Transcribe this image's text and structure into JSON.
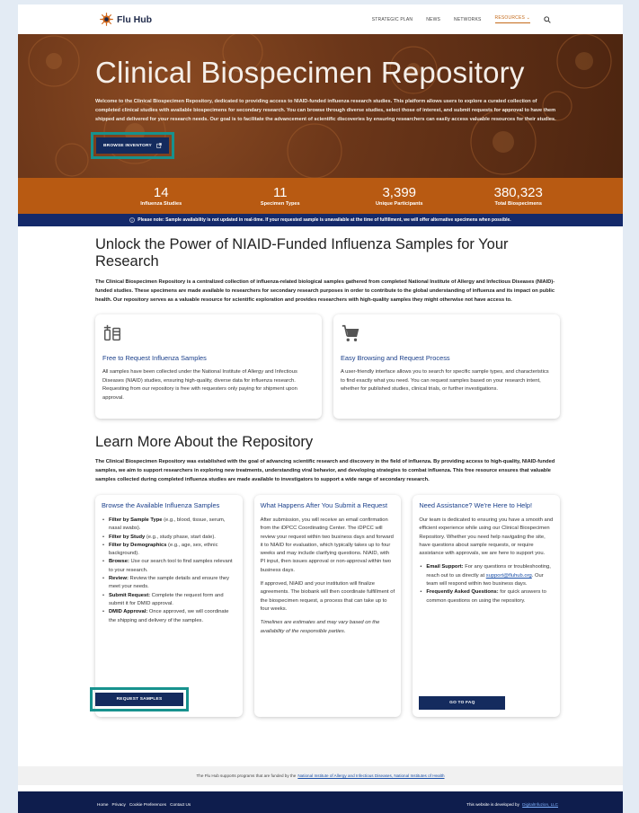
{
  "header": {
    "logo_text": "Flu Hub",
    "nav": [
      "STRATEGIC PLAN",
      "NEWS",
      "NETWORKS",
      "RESOURCES ⌄"
    ],
    "active_nav_index": 3
  },
  "hero": {
    "title": "Clinical Biospecimen Repository",
    "description": "Welcome to the Clinical Biospecimen Repository, dedicated to providing access to NIAID-funded influenza research studies. This platform allows users to explore a curated collection of completed clinical studies with available biospecimens for secondary research. You can browse through diverse studies, select those of interest, and submit requests for approval to have them shipped and delivered for your research needs. Our goal is to facilitate the advancement of scientific discoveries by ensuring researchers can easily access valuable resources for their studies.",
    "browse_label": "BROWSE INVENTORY"
  },
  "stats": [
    {
      "value": "14",
      "label": "Influenza Studies"
    },
    {
      "value": "11",
      "label": "Specimen Types"
    },
    {
      "value": "3,399",
      "label": "Unique Participants"
    },
    {
      "value": "380,323",
      "label": "Total Biospecimens"
    }
  ],
  "notice": "Please note: Sample availability is not updated in real-time. If your requested sample is unavailable at the time of fulfillment, we will offer alternative specimens when possible.",
  "section1": {
    "title": "Unlock the Power of NIAID-Funded Influenza Samples for Your Research",
    "paragraph": "The Clinical Biospecimen Repository is a centralized collection of influenza-related biological samples gathered from completed National Institute of Allergy and Infectious Diseases (NIAID)-funded studies. These specimens are made available to researchers for secondary research purposes in order to contribute to the global understanding of influenza and its impact on public health. Our repository serves as a valuable resource for scientific exploration and provides researchers with high-quality samples they might otherwise not have access to.",
    "cards": [
      {
        "title": "Free to Request Influenza Samples",
        "text": "All samples have been collected under the National Institute of Allergy and Infectious Diseases (NIAID) studies, ensuring high-quality, diverse data for influenza research. Requesting from our repository is free with requesters only paying for shipment upon approval."
      },
      {
        "title": "Easy Browsing and Request Process",
        "text": "A user-friendly interface allows you to search for specific sample types, and characteristics to find exactly what you need. You can request samples based on your research intent, whether for published studies, clinical trials, or further investigations."
      }
    ]
  },
  "section2": {
    "title": "Learn More About the Repository",
    "paragraph": "The Clinical Biospecimen Repository was established with the goal of advancing scientific research and discovery in the field of influenza. By providing access to high-quality, NIAID-funded samples, we aim to support researchers in exploring new treatments, understanding viral behavior, and developing strategies to combat influenza. This free resource ensures that valuable samples collected during completed influenza studies are made available to investigators to support a wide range of secondary research."
  },
  "card_browse": {
    "title": "Browse the Available Influenza Samples",
    "items": [
      {
        "b": "Filter by Sample Type",
        "t": " (e.g., blood, tissue, serum, nasal swabs)."
      },
      {
        "b": "Filter by Study",
        "t": " (e.g., study phase, start date)."
      },
      {
        "b": "Filter by Demographics",
        "t": " (e.g., age, sex, ethnic background)."
      },
      {
        "b": "Browse:",
        "t": " Use our search tool to find samples relevant to your research."
      },
      {
        "b": "Review:",
        "t": " Review the sample details and ensure they meet your needs."
      },
      {
        "b": "Submit Request:",
        "t": " Complete the request form and submit it for DMID approval."
      },
      {
        "b": "DMID Approval:",
        "t": " Once approved, we will coordinate the shipping and delivery of the samples."
      }
    ],
    "button": "REQUEST SAMPLES"
  },
  "card_after": {
    "title": "What Happens After You Submit a Request",
    "p1": "After submission, you will receive an email confirmation from the iDPCC Coordinating Center. The iDPCC will review your request within two business days and forward it to NIAID for evaluation, which typically takes up to four weeks and may include clarifying questions. NIAID, with PI input, then issues approval or non-approval within two business days.",
    "p2": "If approved, NIAID and your institution will finalize agreements. The biobank will then coordinate fulfillment of the biospecimen request, a process that can take up to four weeks.",
    "p3": "Timelines are estimates and may vary based on the availability of the responsible parties."
  },
  "card_help": {
    "title": "Need Assistance? We're Here to Help!",
    "p1": "Our team is dedicated to ensuring you have a smooth and efficient experience while using our Clinical Biospecimen Repository. Whether you need help navigating the site, have questions about sample requests, or require assistance with approvals, we are here to support you.",
    "email_label": "Email Support:",
    "email_pre": " For any questions or troubleshooting, reach out to us directly at ",
    "email": "support@fluhub.org",
    "email_post": ". Our team will respond within two business days.",
    "faq_label": "Frequently Asked Questions:",
    "faq_text": " for quick answers to common questions on using the repository.",
    "button": "GO TO FAQ"
  },
  "funding": {
    "text": "The Flu Hub supports programs that are funded by the",
    "link": "National Institute of Allergy and Infectious Diseases, National Institutes of Health"
  },
  "footer": {
    "links": [
      "Home",
      "Privacy",
      "Cookie Preferences",
      "Contact Us"
    ],
    "dev_text": "This website is developed by",
    "dev_link": "DigitalInfuzion, LLC"
  },
  "colors": {
    "hero_brown": "#6b3619",
    "stats_orange": "#b85a12",
    "navy": "#14296a",
    "teal_highlight": "#17928e",
    "link_blue": "#1a4fa8"
  },
  "icons": [
    "flu-hub-logo-icon",
    "search-icon",
    "external-link-icon",
    "info-icon",
    "vials-icon",
    "cart-icon"
  ]
}
